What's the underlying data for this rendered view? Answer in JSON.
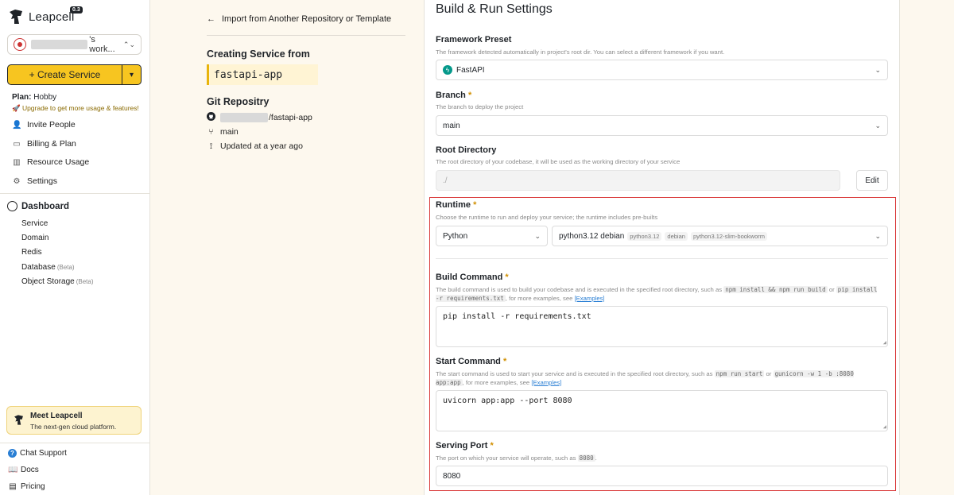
{
  "sidebar": {
    "brand": "Leapcell",
    "version": "0.3",
    "workspace_suffix": "'s work...",
    "create_label": "+ Create Service",
    "plan_label": "Plan:",
    "plan_value": "Hobby",
    "upgrade_text": "🚀 Upgrade to get more usage & features!",
    "menu": [
      {
        "label": "Invite People"
      },
      {
        "label": "Billing & Plan"
      },
      {
        "label": "Resource Usage"
      },
      {
        "label": "Settings"
      }
    ],
    "dashboard_title": "Dashboard",
    "dashboard_items": [
      {
        "label": "Service"
      },
      {
        "label": "Domain"
      },
      {
        "label": "Redis"
      },
      {
        "label": "Database",
        "badge": "(Beta)"
      },
      {
        "label": "Object Storage",
        "badge": "(Beta)"
      }
    ],
    "meet": {
      "title": "Meet Leapcell",
      "subtitle": "The next-gen cloud platform."
    },
    "footer": [
      {
        "label": "Chat Support"
      },
      {
        "label": "Docs"
      },
      {
        "label": "Pricing"
      }
    ]
  },
  "middle": {
    "back_label": "Import from Another Repository or Template",
    "creating_title": "Creating Service from",
    "service_name": "fastapi-app",
    "repo_title": "Git Repositry",
    "repo_suffix": "/fastapi-app",
    "branch": "main",
    "updated": "Updated at a year ago"
  },
  "panel": {
    "title": "Build & Run Settings",
    "framework": {
      "label": "Framework Preset",
      "help": "The framework detected automatically in project's root dir. You can select a different framework if you want.",
      "value": "FastAPI"
    },
    "branch": {
      "label": "Branch",
      "help": "The branch to deploy the project",
      "value": "main"
    },
    "root": {
      "label": "Root Directory",
      "help": "The root directory of your codebase, it will be used as the working directory of your service",
      "placeholder": "./",
      "edit_label": "Edit"
    },
    "runtime": {
      "label": "Runtime",
      "help": "Choose the runtime to run and deploy your service; the runtime includes pre-builts",
      "language": "Python",
      "image": "python3.12 debian",
      "tags": [
        "python3.12",
        "debian",
        "python3.12-slim-bookworm"
      ]
    },
    "build": {
      "label": "Build Command",
      "help_1": "The build command is used to build your codebase and is executed in the specified root directory, such as",
      "chip_1": "npm install && npm run build",
      "or": "or",
      "chip_2": "pip install -r requirements.txt",
      "help_2": ", for more examples, see",
      "link": "[Examples]",
      "value": "pip install -r requirements.txt"
    },
    "start": {
      "label": "Start Command",
      "help_1": "The start command is used to start your service and is executed in the specified root directory, such as",
      "chip_1": "npm run start",
      "or": "or",
      "chip_2": "gunicorn -w 1 -b :8080 app:app",
      "help_2": ", for more examples, see",
      "link": "[Examples]",
      "value": "uvicorn app:app --port 8080"
    },
    "port": {
      "label": "Serving Port",
      "help": "The port on which your service will operate, such as",
      "chip": "8080",
      "value": "8080"
    },
    "required_mark": "*"
  },
  "colors": {
    "accent": "#f7c520",
    "highlight": "#d93636",
    "link": "#2a7fd4"
  }
}
